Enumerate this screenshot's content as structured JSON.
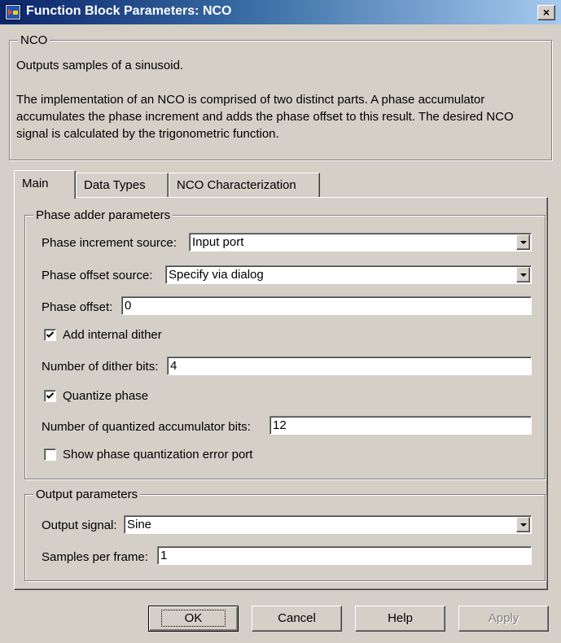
{
  "window": {
    "title": "Function Block Parameters: NCO",
    "close_label": "×"
  },
  "block": {
    "group_title": "NCO",
    "description_line1": "Outputs samples of a sinusoid.",
    "description_line2": "The implementation of an NCO is comprised of two distinct parts. A phase accumulator accumulates the phase increment and adds the phase offset to this result. The desired NCO signal is calculated by the trigonometric function."
  },
  "tabs": [
    {
      "label": "Main",
      "active": true
    },
    {
      "label": "Data Types",
      "active": false
    },
    {
      "label": "NCO Characterization",
      "active": false
    }
  ],
  "phase_adder": {
    "group_title": "Phase adder parameters",
    "phase_increment_source_label": "Phase increment source:",
    "phase_increment_source_value": "Input port",
    "phase_offset_source_label": "Phase offset source:",
    "phase_offset_source_value": "Specify via dialog",
    "phase_offset_label": "Phase offset:",
    "phase_offset_value": "0",
    "add_dither_label": "Add internal dither",
    "add_dither_checked": true,
    "dither_bits_label": "Number of dither bits:",
    "dither_bits_value": "4",
    "quantize_phase_label": "Quantize phase",
    "quantize_phase_checked": true,
    "quantized_bits_label": "Number of quantized accumulator bits:",
    "quantized_bits_value": "12",
    "show_error_port_label": "Show phase quantization error port",
    "show_error_port_checked": false
  },
  "output": {
    "group_title": "Output parameters",
    "output_signal_label": "Output signal:",
    "output_signal_value": "Sine",
    "samples_per_frame_label": "Samples per frame:",
    "samples_per_frame_value": "1"
  },
  "buttons": {
    "ok": "OK",
    "cancel": "Cancel",
    "help": "Help",
    "apply": "Apply"
  },
  "icons": {
    "app": "simulink-block-icon",
    "close": "close-icon",
    "check": "checkmark-icon",
    "dropdown": "chevron-down-icon"
  }
}
